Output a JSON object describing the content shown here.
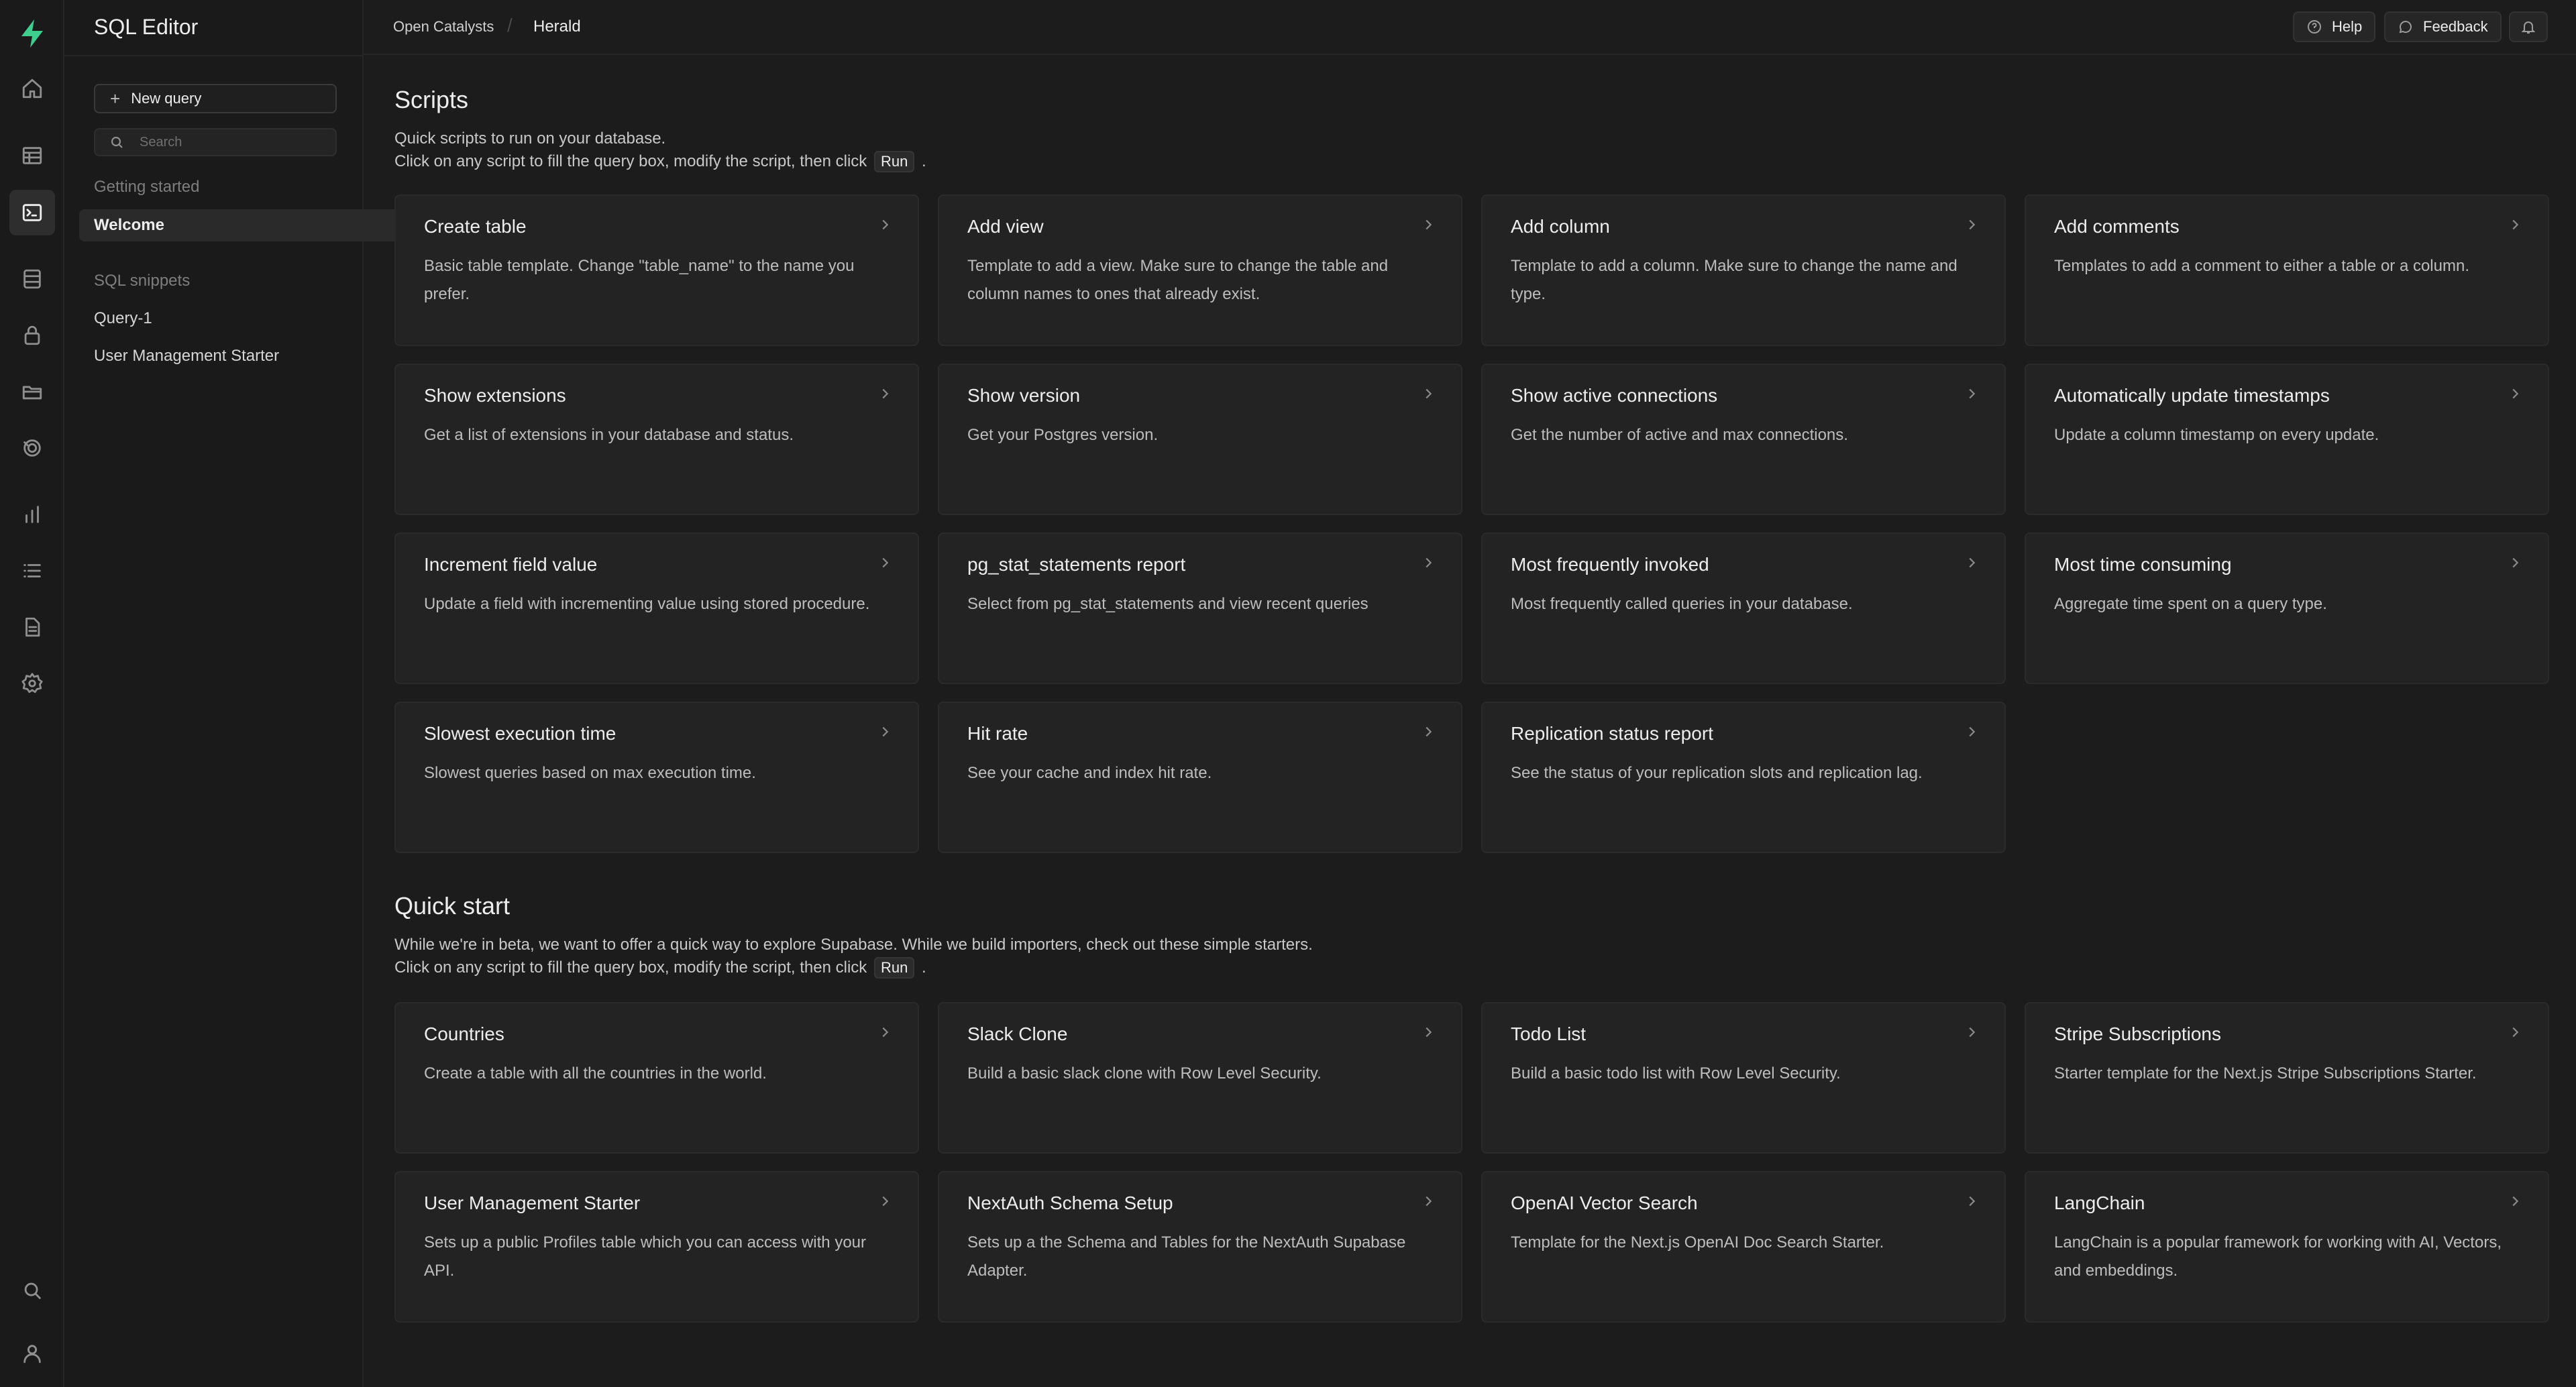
{
  "app": {
    "title": "SQL Editor",
    "breadcrumb": [
      "Open Catalysts",
      "Herald"
    ]
  },
  "topbar": {
    "help_label": "Help",
    "feedback_label": "Feedback"
  },
  "sidebar": {
    "new_query_label": "New query",
    "search_placeholder": "Search",
    "getting_started_heading": "Getting started",
    "welcome_label": "Welcome",
    "snippets_heading": "SQL snippets",
    "snippets": [
      "Query-1",
      "User Management Starter"
    ]
  },
  "scripts": {
    "title": "Scripts",
    "desc_line1": "Quick scripts to run on your database.",
    "desc_line2_prefix": "Click on any script to fill the query box, modify the script, then click",
    "run_label": "Run",
    "desc_line2_suffix": ".",
    "cards": [
      {
        "title": "Create table",
        "desc": "Basic table template. Change \"table_name\" to the name you prefer."
      },
      {
        "title": "Add view",
        "desc": "Template to add a view. Make sure to change the table and column names to ones that already exist."
      },
      {
        "title": "Add column",
        "desc": "Template to add a column. Make sure to change the name and type."
      },
      {
        "title": "Add comments",
        "desc": "Templates to add a comment to either a table or a column."
      },
      {
        "title": "Show extensions",
        "desc": "Get a list of extensions in your database and status."
      },
      {
        "title": "Show version",
        "desc": "Get your Postgres version."
      },
      {
        "title": "Show active connections",
        "desc": "Get the number of active and max connections."
      },
      {
        "title": "Automatically update timestamps",
        "desc": "Update a column timestamp on every update."
      },
      {
        "title": "Increment field value",
        "desc": "Update a field with incrementing value using stored procedure."
      },
      {
        "title": "pg_stat_statements report",
        "desc": "Select from pg_stat_statements and view recent queries"
      },
      {
        "title": "Most frequently invoked",
        "desc": "Most frequently called queries in your database."
      },
      {
        "title": "Most time consuming",
        "desc": "Aggregate time spent on a query type."
      },
      {
        "title": "Slowest execution time",
        "desc": "Slowest queries based on max execution time."
      },
      {
        "title": "Hit rate",
        "desc": "See your cache and index hit rate."
      },
      {
        "title": "Replication status report",
        "desc": "See the status of your replication slots and replication lag."
      }
    ]
  },
  "quickstart": {
    "title": "Quick start",
    "desc_line1": "While we're in beta, we want to offer a quick way to explore Supabase. While we build importers, check out these simple starters.",
    "desc_line2_prefix": "Click on any script to fill the query box, modify the script, then click",
    "run_label": "Run",
    "desc_line2_suffix": ".",
    "cards": [
      {
        "title": "Countries",
        "desc": "Create a table with all the countries in the world."
      },
      {
        "title": "Slack Clone",
        "desc": "Build a basic slack clone with Row Level Security."
      },
      {
        "title": "Todo List",
        "desc": "Build a basic todo list with Row Level Security."
      },
      {
        "title": "Stripe Subscriptions",
        "desc": "Starter template for the Next.js Stripe Subscriptions Starter."
      },
      {
        "title": "User Management Starter",
        "desc": "Sets up a public Profiles table which you can access with your API."
      },
      {
        "title": "NextAuth Schema Setup",
        "desc": "Sets up a the Schema and Tables for the NextAuth Supabase Adapter."
      },
      {
        "title": "OpenAI Vector Search",
        "desc": "Template for the Next.js OpenAI Doc Search Starter."
      },
      {
        "title": "LangChain",
        "desc": "LangChain is a popular framework for working with AI, Vectors, and embeddings."
      }
    ]
  },
  "icons": {
    "rail": [
      "supabase-logo",
      "home-icon",
      "table-editor-icon",
      "sql-editor-icon",
      "database-icon",
      "auth-icon",
      "storage-icon",
      "realtime-icon",
      "reports-icon",
      "logs-icon",
      "api-docs-icon",
      "settings-icon",
      "search-icon",
      "user-icon"
    ]
  },
  "colors": {
    "brand": "#3ecf8e",
    "background": "#1c1c1c",
    "card": "#232323"
  }
}
